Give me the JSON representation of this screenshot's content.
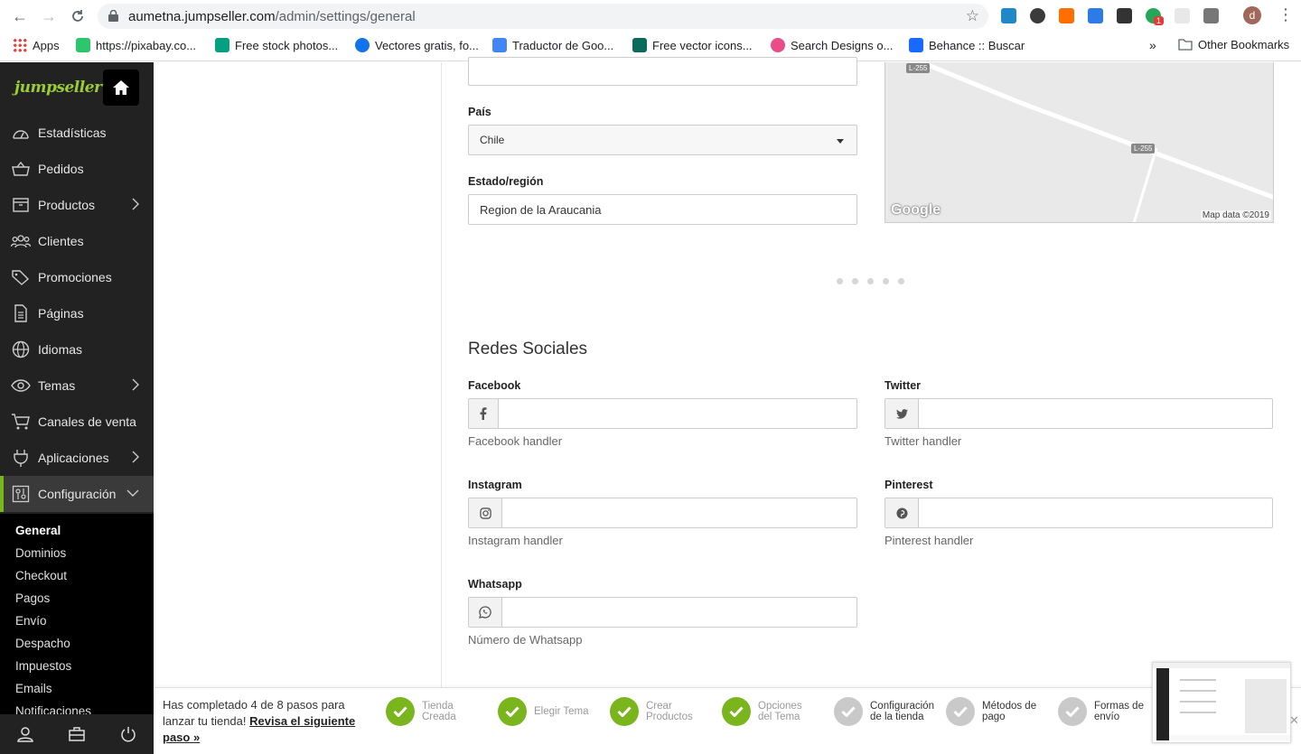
{
  "browser": {
    "url_host": "aumetna.jumpseller.com",
    "url_path": "/admin/settings/general",
    "bookmarks": [
      {
        "label": "Apps",
        "color": "#e94235"
      },
      {
        "label": "https://pixabay.co...",
        "color": "#2ec66d"
      },
      {
        "label": "Free stock photos...",
        "color": "#05a081"
      },
      {
        "label": "Vectores gratis, fo...",
        "color": "#1273eb"
      },
      {
        "label": "Traductor de Goo...",
        "color": "#4285f4"
      },
      {
        "label": "Free vector icons...",
        "color": "#0a6b5c"
      },
      {
        "label": "Search Designs o...",
        "color": "#ea4c89"
      },
      {
        "label": "Behance :: Buscar",
        "color": "#1769ff"
      }
    ],
    "other_bookmarks": "Other Bookmarks",
    "overflow": "»",
    "profile_initial": "d",
    "ext_badge": "1"
  },
  "sidebar": {
    "logo": "jumpseller",
    "items": [
      {
        "label": "Estadísticas",
        "icon": "gauge-icon",
        "chevron": false
      },
      {
        "label": "Pedidos",
        "icon": "basket-icon",
        "chevron": false
      },
      {
        "label": "Productos",
        "icon": "box-icon",
        "chevron": true
      },
      {
        "label": "Clientes",
        "icon": "users-icon",
        "chevron": false
      },
      {
        "label": "Promociones",
        "icon": "tag-icon",
        "chevron": false
      },
      {
        "label": "Páginas",
        "icon": "page-icon",
        "chevron": false
      },
      {
        "label": "Idiomas",
        "icon": "globe-icon",
        "chevron": false
      },
      {
        "label": "Temas",
        "icon": "eye-icon",
        "chevron": true
      },
      {
        "label": "Canales de venta",
        "icon": "cart-icon",
        "chevron": false
      },
      {
        "label": "Aplicaciones",
        "icon": "plug-icon",
        "chevron": true
      },
      {
        "label": "Configuración",
        "icon": "settings-icon",
        "chevron": true
      }
    ],
    "submenu": [
      "General",
      "Dominios",
      "Checkout",
      "Pagos",
      "Envío",
      "Despacho",
      "Impuestos",
      "Emails",
      "Notificaciones"
    ]
  },
  "form": {
    "pais_label": "País",
    "pais_value": "Chile",
    "region_label": "Estado/región",
    "region_value": "Region de la Araucania",
    "map": {
      "road1": "L-255",
      "road2": "L-255",
      "brand": "Google",
      "attribution": "Map data ©2019"
    },
    "social_title": "Redes Sociales",
    "facebook_label": "Facebook",
    "facebook_help": "Facebook handler",
    "twitter_label": "Twitter",
    "twitter_help": "Twitter handler",
    "instagram_label": "Instagram",
    "instagram_help": "Instagram handler",
    "pinterest_label": "Pinterest",
    "pinterest_help": "Pinterest handler",
    "whatsapp_label": "Whatsapp",
    "whatsapp_help": "Número de Whatsapp"
  },
  "progress": {
    "message": "Has completado 4 de 8 pasos para lanzar tu tienda!",
    "link": "Revisa el siguiente paso »",
    "steps": [
      {
        "line1": "Tienda",
        "line2": "Creada",
        "done": true
      },
      {
        "line1": "Elegir Tema",
        "line2": "",
        "done": true
      },
      {
        "line1": "Crear",
        "line2": "Productos",
        "done": true
      },
      {
        "line1": "Opciones",
        "line2": "del Tema",
        "done": true
      },
      {
        "line1": "Configuración",
        "line2": "de la tienda",
        "done": false
      },
      {
        "line1": "Métodos de",
        "line2": "pago",
        "done": false
      },
      {
        "line1": "Formas de",
        "line2": "envío",
        "done": false
      }
    ]
  }
}
